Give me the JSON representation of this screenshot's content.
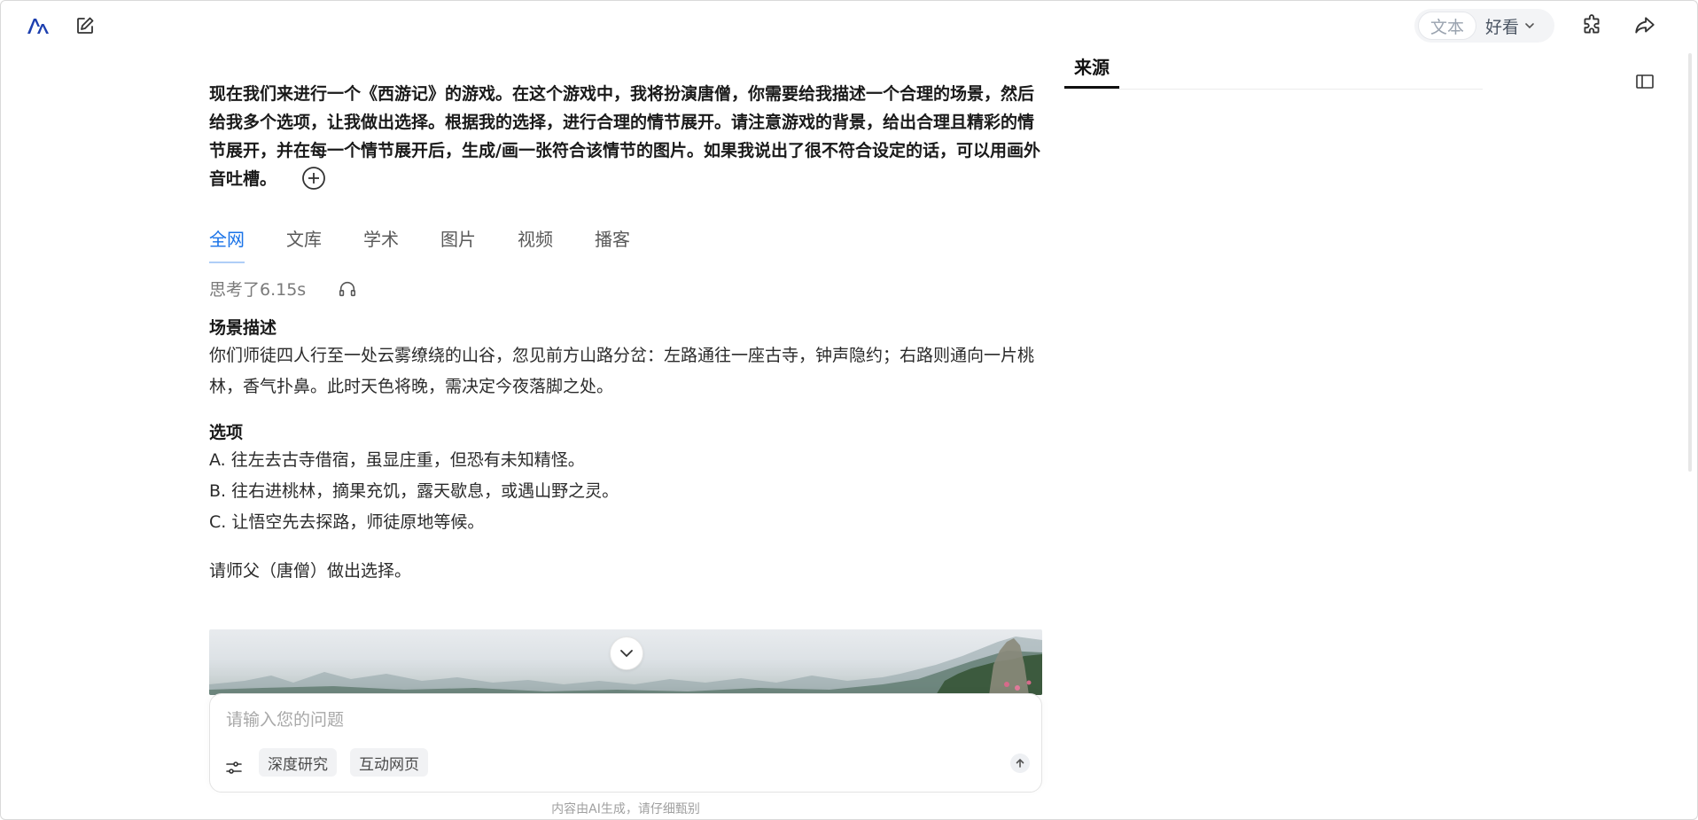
{
  "app": {
    "view_mode": "文本",
    "style_label": "好看"
  },
  "sources": {
    "title": "来源"
  },
  "question": {
    "text": "现在我们来进行一个《西游记》的游戏。在这个游戏中，我将扮演唐僧，你需要给我描述一个合理的场景，然后给我多个选项，让我做出选择。根据我的选择，进行合理的情节展开。请注意游戏的背景，给出合理且精彩的情节展开，并在每一个情节展开后，生成/画一张符合该情节的图片。如果我说出了很不符合设定的话，可以用画外音吐槽。"
  },
  "tabs": [
    {
      "label": "全网",
      "active": true
    },
    {
      "label": "文库"
    },
    {
      "label": "学术"
    },
    {
      "label": "图片"
    },
    {
      "label": "视频"
    },
    {
      "label": "播客"
    }
  ],
  "thinking": {
    "label": "思考了6.15s"
  },
  "answer": {
    "scene_heading": "场景描述",
    "scene_text": "你们师徒四人行至一处云雾缭绕的山谷，忽见前方山路分岔：左路通往一座古寺，钟声隐约；右路则通向一片桃林，香气扑鼻。此时天色将晚，需决定今夜落脚之处。",
    "options_heading": "选项",
    "options": [
      "A. 往左去古寺借宿，虽显庄重，但恐有未知精怪。",
      "B. 往右进桃林，摘果充饥，露天歇息，或遇山野之灵。",
      "C. 让悟空先去探路，师徒原地等候。"
    ],
    "prompt": "请师父（唐僧）做出选择。"
  },
  "composer": {
    "placeholder": "请输入您的问题",
    "chips": [
      "深度研究",
      "互动网页"
    ]
  },
  "footer": {
    "disclaimer": "内容由AI生成，请仔细甄别"
  },
  "colors": {
    "accent": "#1a73e8",
    "logo": "#1e40af"
  }
}
